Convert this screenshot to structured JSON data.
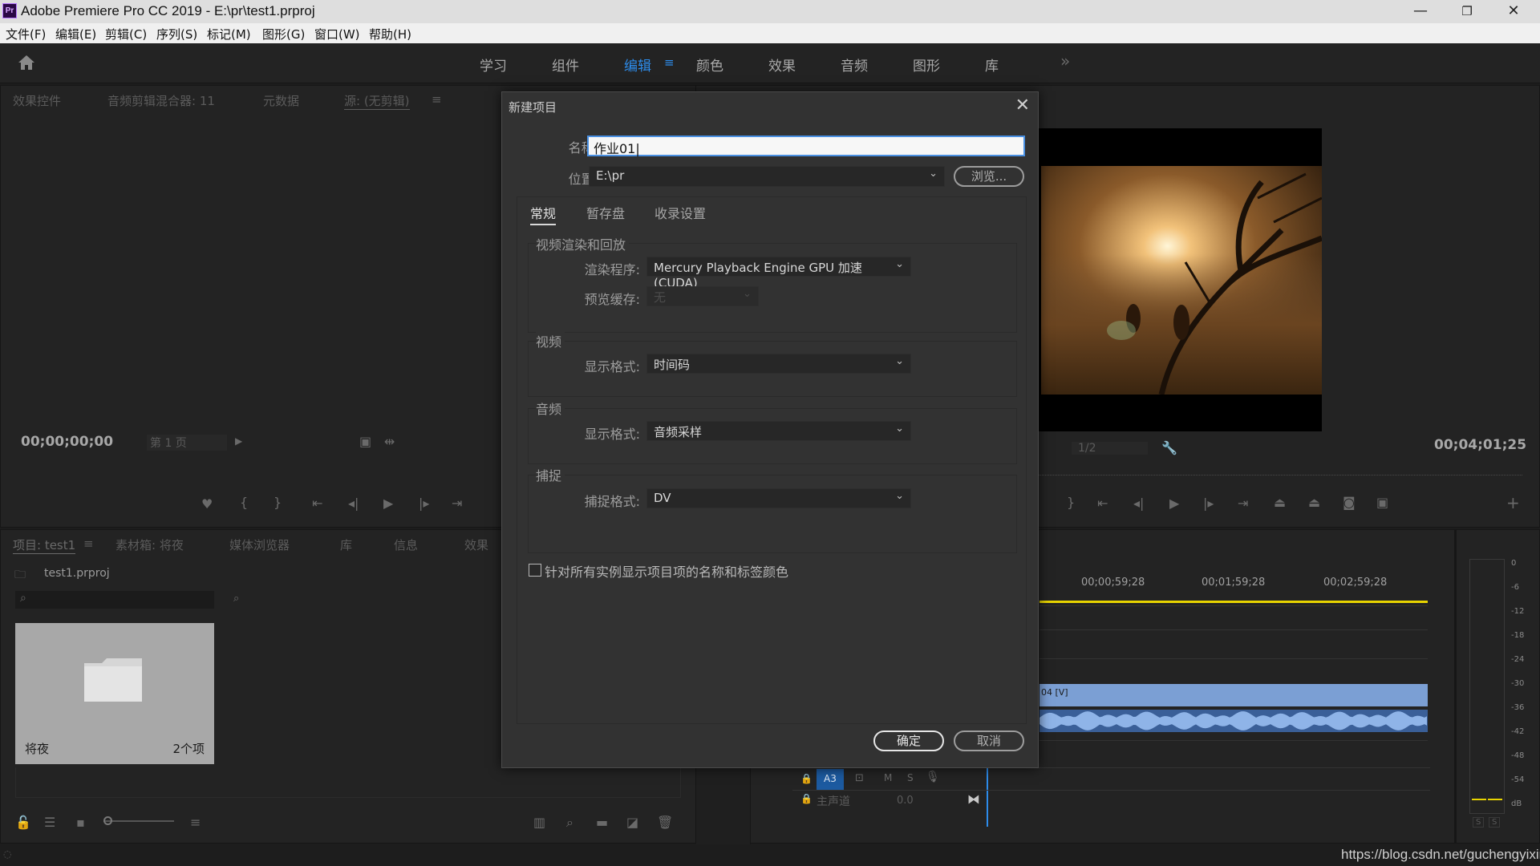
{
  "window": {
    "app_icon_text": "Pr",
    "title": "Adobe Premiere Pro CC 2019 - E:\\pr\\test1.prproj",
    "minimize": "—",
    "restore": "❐",
    "close": "✕"
  },
  "menu": [
    "文件(F)",
    "编辑(E)",
    "剪辑(C)",
    "序列(S)",
    "标记(M)",
    "图形(G)",
    "窗口(W)",
    "帮助(H)"
  ],
  "workspaces": {
    "items": [
      "学习",
      "组件",
      "编辑",
      "颜色",
      "效果",
      "音频",
      "图形",
      "库"
    ],
    "active": "编辑",
    "active_menu_icon": "≡",
    "overflow_icon": "»"
  },
  "source_panel": {
    "tabs": [
      "效果控件",
      "音频剪辑混合器: 11",
      "元数据",
      "源: (无剪辑)"
    ],
    "tab_menu_icon": "≡",
    "timecode": "00;00;00;00",
    "page_select": "第 1 页"
  },
  "program_panel": {
    "fit_select": "1/2",
    "timecode": "00;04;01;25"
  },
  "project_panel": {
    "tabs": [
      "项目: test1",
      "素材箱: 将夜",
      "媒体浏览器",
      "库",
      "信息",
      "效果"
    ],
    "tab_menu_icon": "≡",
    "project_file": "test1.prproj",
    "bin": {
      "name": "将夜",
      "count": "2个项"
    }
  },
  "timeline": {
    "ruler": [
      "00;00;59;28",
      "00;01;59;28",
      "00;02;59;28"
    ],
    "video_clip_label": "04 [V]",
    "track_a3": "A3",
    "track_buttons": [
      "M",
      "S"
    ],
    "master_label": "主声道",
    "master_value": "0.0"
  },
  "meter": {
    "scale": [
      "0",
      "-6",
      "-12",
      "-18",
      "-24",
      "-30",
      "-36",
      "-42",
      "-48",
      "-54",
      "dB"
    ],
    "solo_buttons": [
      "S",
      "S"
    ]
  },
  "dialog": {
    "title": "新建项目",
    "close_icon": "✕",
    "name_label": "名称:",
    "name_value": "作业01",
    "location_label": "位置:",
    "location_value": "E:\\pr",
    "browse_label": "浏览...",
    "tabs": [
      "常规",
      "暂存盘",
      "收录设置"
    ],
    "active_tab": "常规",
    "groups": {
      "render": {
        "title": "视频渲染和回放",
        "renderer_label": "渲染程序:",
        "renderer_value": "Mercury Playback Engine GPU 加速 (CUDA)",
        "preview_cache_label": "预览缓存:",
        "preview_cache_value": "无"
      },
      "video": {
        "title": "视频",
        "format_label": "显示格式:",
        "format_value": "时间码"
      },
      "audio": {
        "title": "音频",
        "format_label": "显示格式:",
        "format_value": "音频采样"
      },
      "capture": {
        "title": "捕捉",
        "format_label": "捕捉格式:",
        "format_value": "DV"
      }
    },
    "checkbox_label": "针对所有实例显示项目项的名称和标签颜色",
    "checkbox_checked": false,
    "ok_label": "确定",
    "cancel_label": "取消"
  },
  "watermark": "https://blog.csdn.net/guchengyixin",
  "colors": {
    "accent_blue": "#2d8ceb",
    "playhead_blue": "#2d8ceb",
    "work_area_yellow": "#e8d400",
    "video_clip": "#7b9fd4"
  }
}
